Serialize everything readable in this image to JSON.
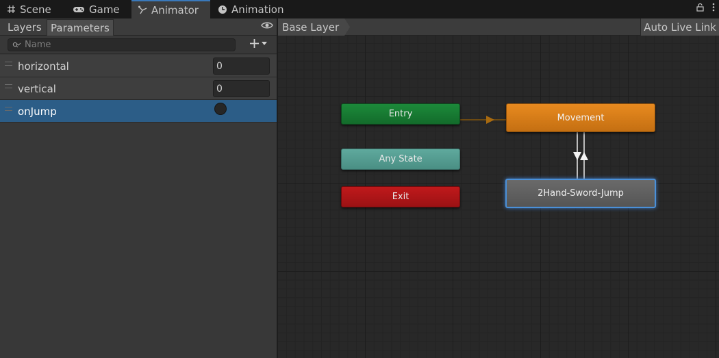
{
  "tabs": [
    {
      "label": "Scene",
      "icon": "grid-icon",
      "active": false
    },
    {
      "label": "Game",
      "icon": "gamepad-icon",
      "active": false
    },
    {
      "label": "Animator",
      "icon": "animator-icon",
      "active": true
    },
    {
      "label": "Animation",
      "icon": "clock-icon",
      "active": false
    }
  ],
  "left_panel": {
    "tabs": [
      "Layers",
      "Parameters"
    ],
    "active_tab": "Parameters",
    "search": {
      "placeholder": "Name",
      "value": ""
    },
    "parameters": [
      {
        "name": "horizontal",
        "type": "float",
        "value": "0",
        "selected": false
      },
      {
        "name": "vertical",
        "type": "float",
        "value": "0",
        "selected": false
      },
      {
        "name": "onJump",
        "type": "trigger",
        "value": "",
        "selected": true
      }
    ]
  },
  "graph": {
    "breadcrumb": "Base Layer",
    "live_link_label": "Auto Live Link",
    "states": {
      "entry": "Entry",
      "any_state": "Any State",
      "exit": "Exit",
      "movement": "Movement",
      "jump": "2Hand-Sword-Jump"
    },
    "colors": {
      "entry": "#1c8a3a",
      "any_state": "#5fa99d",
      "exit": "#c0191b",
      "default_state": "#e88a1f",
      "selected_outline": "#4a90d9"
    }
  }
}
